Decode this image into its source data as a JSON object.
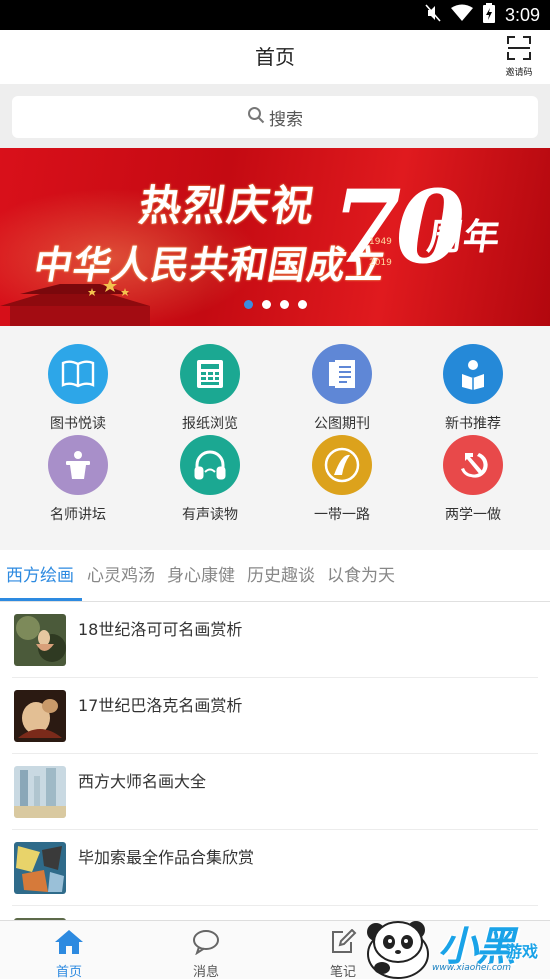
{
  "status_bar": {
    "time": "3:09",
    "icons": [
      "mute-icon",
      "wifi-icon",
      "battery-icon"
    ]
  },
  "header": {
    "title": "首页",
    "invite_label": "邀请码",
    "invite_icon": "scan-icon"
  },
  "search": {
    "placeholder": "搜索",
    "icon": "search-icon"
  },
  "banner": {
    "line1": "热烈庆祝",
    "line2": "中华人民共和国成立",
    "number": "70",
    "line3": "周年",
    "year_start": "1949",
    "year_end": "2019",
    "slides": 4,
    "active_slide": 1
  },
  "grid": {
    "items": [
      {
        "label": "图书悦读",
        "icon": "book-icon",
        "color": "#2da6e8"
      },
      {
        "label": "报纸浏览",
        "icon": "newspaper-icon",
        "color": "#1ba892"
      },
      {
        "label": "公图期刊",
        "icon": "journal-icon",
        "color": "#5f87d6"
      },
      {
        "label": "新书推荐",
        "icon": "reader-icon",
        "color": "#2589d8"
      },
      {
        "label": "名师讲坛",
        "icon": "podium-icon",
        "color": "#a88fc9"
      },
      {
        "label": "有声读物",
        "icon": "headphones-icon",
        "color": "#1ba892"
      },
      {
        "label": "一带一路",
        "icon": "belt-road-icon",
        "color": "#dca21c"
      },
      {
        "label": "两学一做",
        "icon": "hammer-sickle-icon",
        "color": "#e8494a"
      }
    ]
  },
  "tabs": {
    "items": [
      "西方绘画",
      "心灵鸡汤",
      "身心康健",
      "历史趣谈",
      "以食为天"
    ],
    "active": 0
  },
  "list": {
    "items": [
      {
        "title": "18世纪洛可可名画赏析"
      },
      {
        "title": "17世纪巴洛克名画赏析"
      },
      {
        "title": "西方大师名画大全"
      },
      {
        "title": "毕加索最全作品合集欣赏"
      }
    ]
  },
  "bottom_nav": {
    "items": [
      {
        "label": "首页",
        "icon": "home-icon",
        "active": true
      },
      {
        "label": "消息",
        "icon": "message-icon",
        "active": false
      },
      {
        "label": "笔记",
        "icon": "note-icon",
        "active": false
      }
    ]
  },
  "watermark": {
    "text": "小黑",
    "suffix": "游戏",
    "url": "www.xiaohei.com"
  },
  "colors": {
    "accent": "#2d8ae0",
    "banner_red": "#d9101a"
  }
}
